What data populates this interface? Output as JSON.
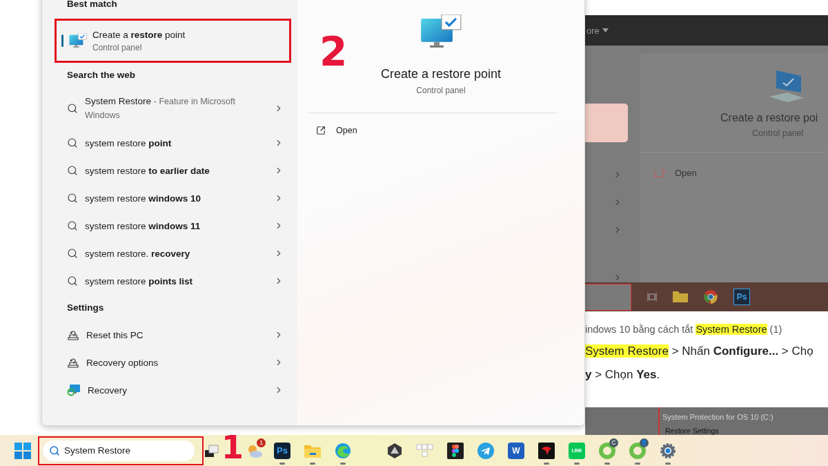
{
  "start_menu": {
    "best_match": {
      "heading": "Best match",
      "item": {
        "title": "Create a **restore** point",
        "subtitle": "Control panel",
        "selected": true,
        "highlighted": true
      }
    },
    "web": {
      "heading": "Search the web",
      "items": [
        {
          "text": "System Restore",
          "detail": "- Feature in Microsoft Windows"
        },
        {
          "text": "system restore **point**"
        },
        {
          "text": "system restore **to earlier date**"
        },
        {
          "text": "system restore **windows 10**"
        },
        {
          "text": "system restore **windows 11**"
        },
        {
          "text": "system restore. **recovery**"
        },
        {
          "text": "system restore **points list**"
        }
      ]
    },
    "settings": {
      "heading": "Settings",
      "items": [
        {
          "label": "Reset this PC",
          "kind": "reset"
        },
        {
          "label": "Recovery options",
          "kind": "reset"
        },
        {
          "label": "Recovery",
          "kind": "recovery"
        }
      ]
    },
    "preview": {
      "step": "2",
      "title": "Create a restore point",
      "subtitle": "Control panel",
      "actions": [
        {
          "label": "Open"
        }
      ]
    }
  },
  "background": {
    "menu_label": "ore",
    "preview_title": "Create a restore poi",
    "preview_subtitle": "Control panel",
    "open_label": "Open",
    "taskbar_label": "Ps",
    "article_lines": [
      [
        {
          "kind": "plain",
          "text": "indows 10 bằng cách tắt "
        },
        {
          "kind": "highlight",
          "text": "System Restore"
        },
        {
          "kind": "plain",
          "text": " (1)"
        }
      ],
      [
        {
          "kind": "highlight",
          "text": "System Restore"
        },
        {
          "kind": "plain",
          "text": " > Nhấn "
        },
        {
          "kind": "bold",
          "text": "Configure..."
        },
        {
          "kind": "plain",
          "text": " > Chọ"
        }
      ],
      [
        {
          "kind": "bold",
          "text": "y"
        },
        {
          "kind": "plain",
          "text": " > Chọn "
        },
        {
          "kind": "bold",
          "text": "Yes"
        },
        {
          "kind": "plain",
          "text": "."
        }
      ]
    ],
    "dialog_title": "System Protection for OS 10 (C:)",
    "dialog_section": "Restore Settings"
  },
  "taskbar": {
    "search": {
      "value": "System Restore",
      "highlighted": true
    },
    "step": "1",
    "apps": [
      {
        "kind": "taskview",
        "running": false
      },
      {
        "kind": "weather",
        "badge": "1",
        "running": false
      },
      {
        "kind": "ps",
        "label": "Ps",
        "running": true
      },
      {
        "kind": "folder",
        "running": true
      },
      {
        "kind": "edge",
        "running": true
      },
      {
        "kind": "gem",
        "running": false
      },
      {
        "kind": "keys",
        "running": false
      },
      {
        "kind": "figma",
        "running": false
      },
      {
        "kind": "telegram",
        "running": false
      },
      {
        "kind": "word",
        "label": "W",
        "running": false
      },
      {
        "kind": "garena",
        "running": true
      },
      {
        "kind": "line",
        "label": "LINE",
        "running": true
      },
      {
        "kind": "ring",
        "badge": "C",
        "running": true
      },
      {
        "kind": "ring",
        "badge": "👤",
        "running": true
      },
      {
        "kind": "gear",
        "running": true
      }
    ]
  }
}
